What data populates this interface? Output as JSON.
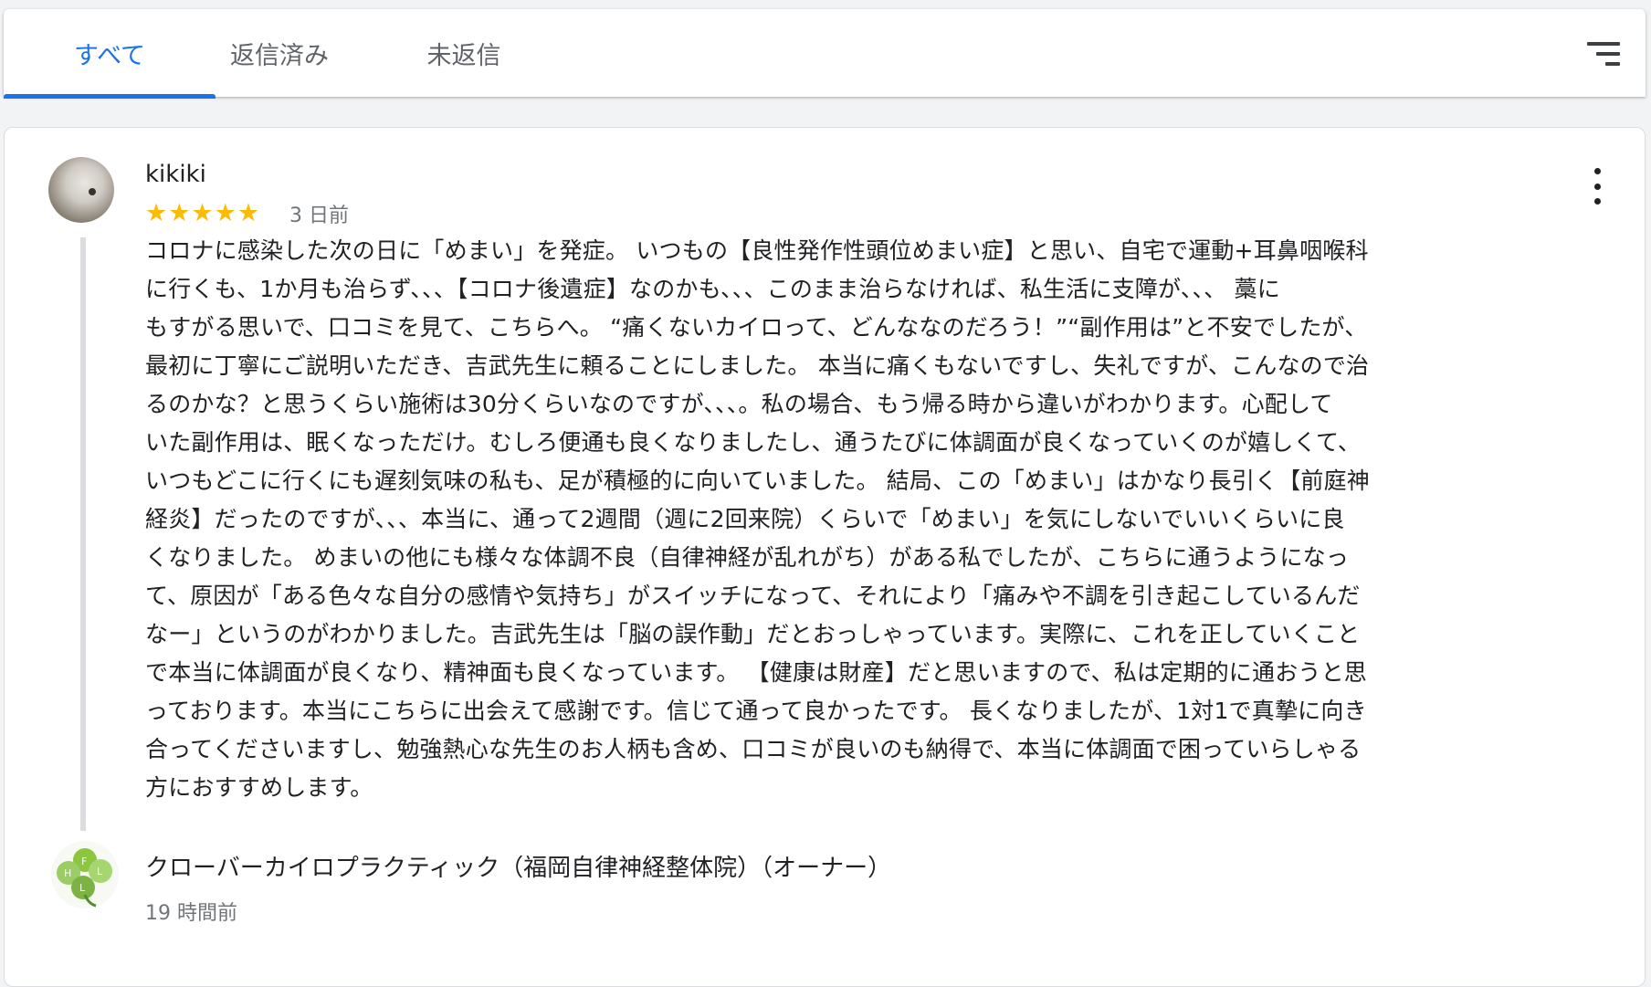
{
  "tabs": [
    {
      "label": "すべて",
      "active": true
    },
    {
      "label": "返信済み",
      "active": false
    },
    {
      "label": "未返信",
      "active": false
    }
  ],
  "icons": {
    "sort": "sort-lines-icon",
    "more": "more-vert-icon"
  },
  "colors": {
    "accent": "#1a73e8",
    "star": "#fbbc04",
    "secondary_text": "#70757a"
  },
  "review": {
    "reviewer_name": "kikiki",
    "rating": 5,
    "stars": "★★★★★",
    "date": "3 日前",
    "text": [
      "コロナに感染した次の日に「めまい」を発症。 いつもの【良性発作性頭位めまい症】と思い、自宅で運動+耳鼻咽喉科",
      "に行くも、1か月も治らず、、、【コロナ後遺症】なのかも、、、このまま治らなければ、私生活に支障が、、、 藁に",
      "もすがる思いで、口コミを見て、こちらへ。 “痛くないカイロって、どんななのだろう！”“副作用は”と不安でしたが、",
      "最初に丁寧にご説明いただき、吉武先生に頼ることにしました。 本当に痛くもないですし、失礼ですが、こんなので治",
      "るのかな？と思うくらい施術は30分くらいなのですが、、、。私の場合、もう帰る時から違いがわかります。心配して",
      "いた副作用は、眠くなっただけ。むしろ便通も良くなりましたし、通うたびに体調面が良くなっていくのが嬉しくて、",
      "いつもどこに行くにも遅刻気味の私も、足が積極的に向いていました。 結局、この「めまい」はかなり長引く【前庭神",
      "経炎】だったのですが、、、本当に、通って2週間（週に2回来院）くらいで「めまい」を気にしないでいいくらいに良",
      "くなりました。 めまいの他にも様々な体調不良（自律神経が乱れがち）がある私でしたが、こちらに通うようになっ",
      "て、原因が「ある色々な自分の感情や気持ち」がスイッチになって、それにより「痛みや不調を引き起こしているんだ",
      "なー」というのがわかりました。吉武先生は「脳の誤作動」だとおっしゃっています。実際に、これを正していくこと",
      "で本当に体調面が良くなり、精神面も良くなっています。 【健康は財産】だと思いますので、私は定期的に通おうと思",
      "っております。本当にこちらに出会えて感謝です。信じて通って良かったです。 長くなりましたが、1対1で真摯に向き",
      "合ってくださいますし、勉強熱心な先生のお人柄も含め、口コミが良いのも納得で、本当に体調面で困っていらしゃる",
      "方におすすめします。"
    ]
  },
  "reply": {
    "owner_name": "クローバーカイロプラクティック（福岡自律神経整体院）（オーナー）",
    "date": "19 時間前"
  }
}
